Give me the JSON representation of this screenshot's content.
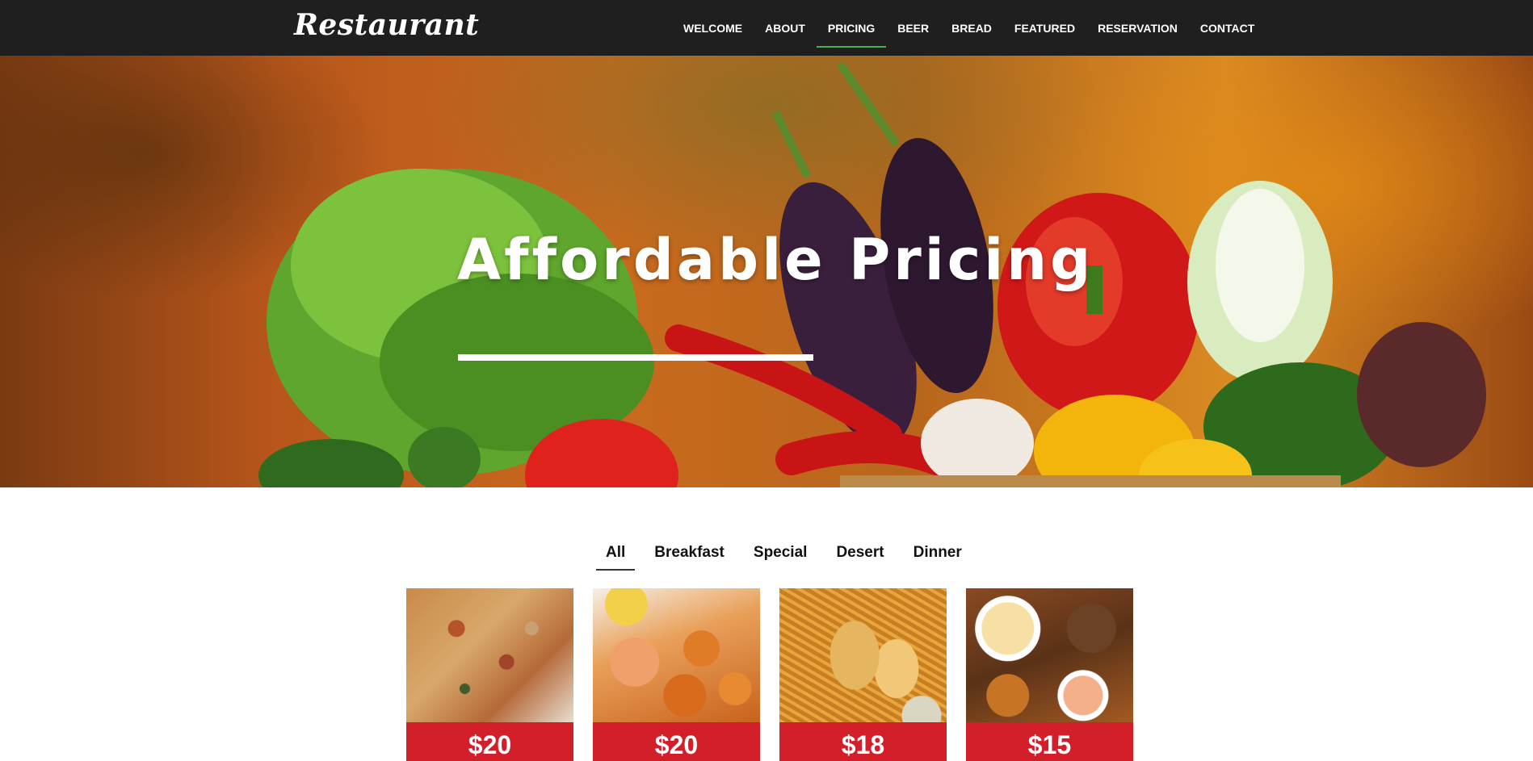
{
  "brand": {
    "logo": "Restaurant"
  },
  "nav": {
    "items": [
      {
        "label": "WELCOME",
        "active": false
      },
      {
        "label": "ABOUT",
        "active": false
      },
      {
        "label": "PRICING",
        "active": true
      },
      {
        "label": "BEER",
        "active": false
      },
      {
        "label": "BREAD",
        "active": false
      },
      {
        "label": "FEATURED",
        "active": false
      },
      {
        "label": "RESERVATION",
        "active": false
      },
      {
        "label": "CONTACT",
        "active": false
      }
    ],
    "active_color": "#4caf50"
  },
  "hero": {
    "title": "Affordable Pricing"
  },
  "filters": {
    "tabs": [
      {
        "label": "All",
        "active": true
      },
      {
        "label": "Breakfast",
        "active": false
      },
      {
        "label": "Special",
        "active": false
      },
      {
        "label": "Desert",
        "active": false
      },
      {
        "label": "Dinner",
        "active": false
      }
    ]
  },
  "menu": {
    "items": [
      {
        "price": "$20",
        "image": "pizza"
      },
      {
        "price": "$20",
        "image": "fried-shrimp"
      },
      {
        "price": "$18",
        "image": "fish-and-chips"
      },
      {
        "price": "$15",
        "image": "wings-platter"
      }
    ],
    "price_bg": "#d31f2a"
  }
}
